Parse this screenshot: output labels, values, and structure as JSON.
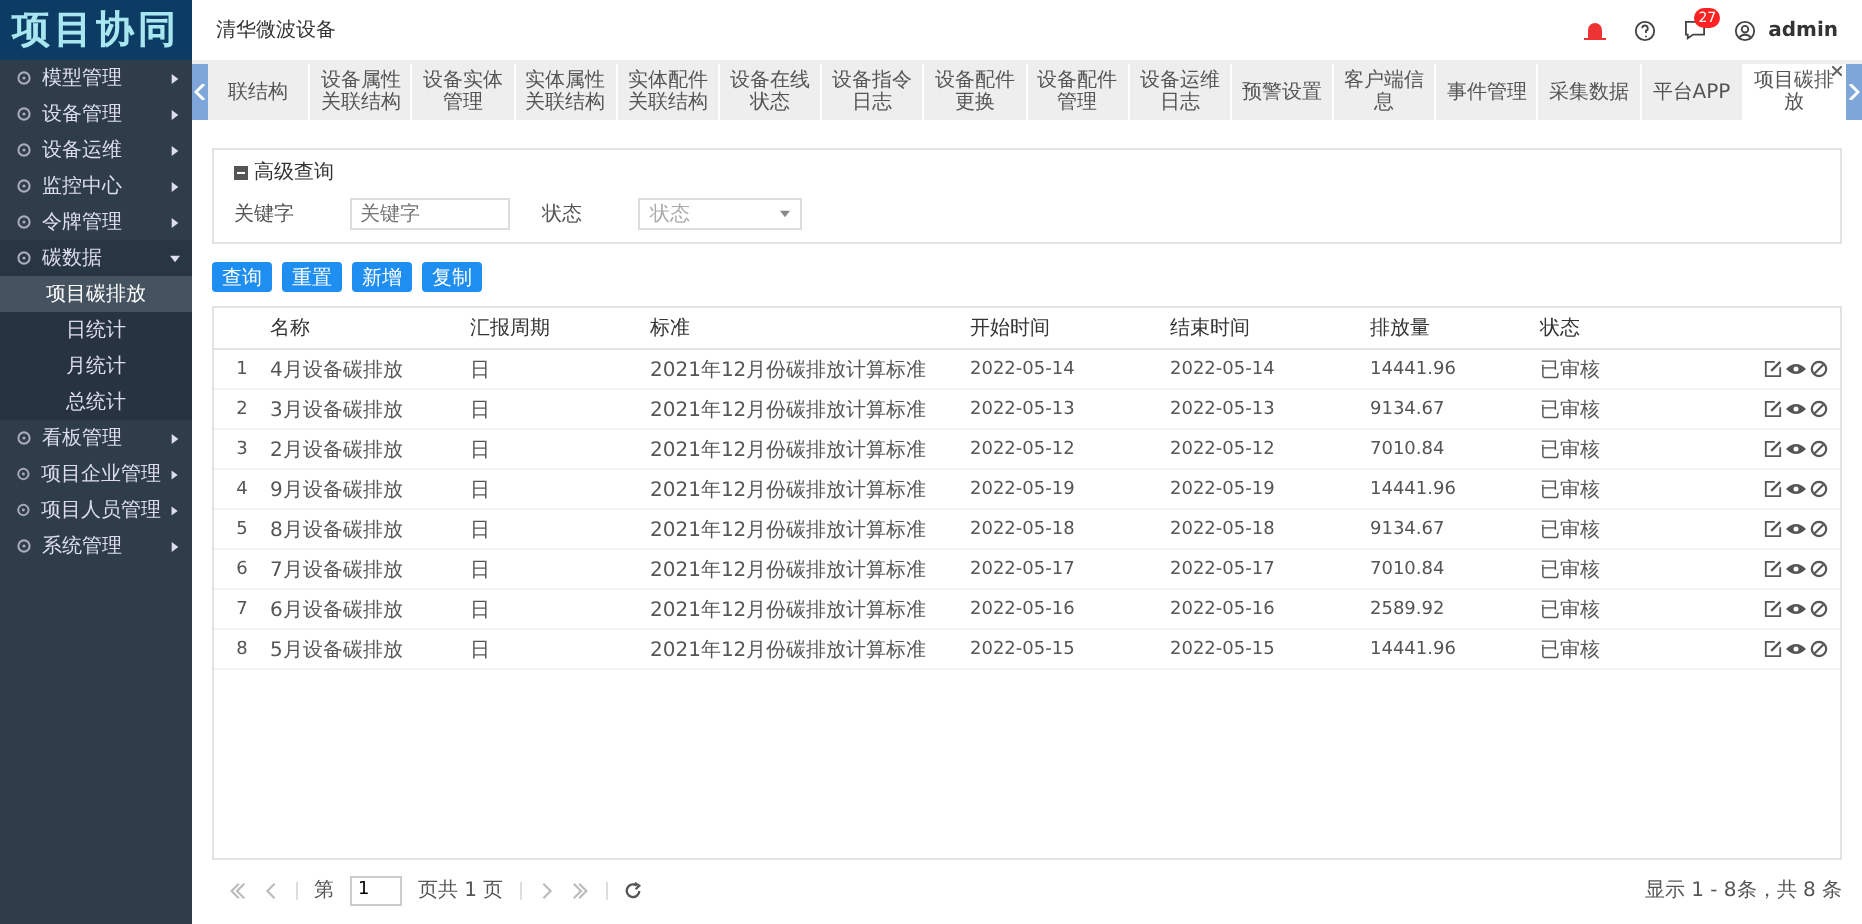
{
  "logo": "项目协同",
  "sidebar": {
    "items": [
      {
        "label": "模型管理",
        "expanded": false
      },
      {
        "label": "设备管理",
        "expanded": false
      },
      {
        "label": "设备运维",
        "expanded": false
      },
      {
        "label": "监控中心",
        "expanded": false
      },
      {
        "label": "令牌管理",
        "expanded": false
      },
      {
        "label": "碳数据",
        "expanded": true,
        "children": [
          {
            "label": "项目碳排放",
            "selected": true
          },
          {
            "label": "日统计",
            "selected": false
          },
          {
            "label": "月统计",
            "selected": false
          },
          {
            "label": "总统计",
            "selected": false
          }
        ]
      },
      {
        "label": "看板管理",
        "expanded": false
      },
      {
        "label": "项目企业管理",
        "expanded": false
      },
      {
        "label": "项目人员管理",
        "expanded": false
      },
      {
        "label": "系统管理",
        "expanded": false
      }
    ]
  },
  "header": {
    "title": "清华微波设备",
    "message_count": "27",
    "user": "admin"
  },
  "tabs": [
    {
      "label": "联结构",
      "selected": false,
      "closable": false
    },
    {
      "label": "设备属性关联结构",
      "selected": false,
      "closable": false
    },
    {
      "label": "设备实体管理",
      "selected": false,
      "closable": false
    },
    {
      "label": "实体属性关联结构",
      "selected": false,
      "closable": false
    },
    {
      "label": "实体配件关联结构",
      "selected": false,
      "closable": false
    },
    {
      "label": "设备在线状态",
      "selected": false,
      "closable": false
    },
    {
      "label": "设备指令日志",
      "selected": false,
      "closable": false
    },
    {
      "label": "设备配件更换",
      "selected": false,
      "closable": false
    },
    {
      "label": "设备配件管理",
      "selected": false,
      "closable": false
    },
    {
      "label": "设备运维日志",
      "selected": false,
      "closable": false
    },
    {
      "label": "预警设置",
      "selected": false,
      "closable": false
    },
    {
      "label": "客户端信息",
      "selected": false,
      "closable": false
    },
    {
      "label": "事件管理",
      "selected": false,
      "closable": false
    },
    {
      "label": "采集数据",
      "selected": false,
      "closable": false
    },
    {
      "label": "平台APP",
      "selected": false,
      "closable": false
    },
    {
      "label": "项目碳排放",
      "selected": true,
      "closable": true
    }
  ],
  "query": {
    "title": "高级查询",
    "keyword_label": "关键字",
    "keyword_placeholder": "关键字",
    "status_label": "状态",
    "status_placeholder": "状态"
  },
  "buttons": [
    "查询",
    "重置",
    "新增",
    "复制"
  ],
  "table": {
    "columns": [
      "",
      "名称",
      "汇报周期",
      "标准",
      "开始时间",
      "结束时间",
      "排放量",
      "状态"
    ],
    "rows": [
      [
        "1",
        "4月设备碳排放",
        "日",
        "2021年12月份碳排放计算标准",
        "2022-05-14",
        "2022-05-14",
        "14441.96",
        "已审核"
      ],
      [
        "2",
        "3月设备碳排放",
        "日",
        "2021年12月份碳排放计算标准",
        "2022-05-13",
        "2022-05-13",
        "9134.67",
        "已审核"
      ],
      [
        "3",
        "2月设备碳排放",
        "日",
        "2021年12月份碳排放计算标准",
        "2022-05-12",
        "2022-05-12",
        "7010.84",
        "已审核"
      ],
      [
        "4",
        "9月设备碳排放",
        "日",
        "2021年12月份碳排放计算标准",
        "2022-05-19",
        "2022-05-19",
        "14441.96",
        "已审核"
      ],
      [
        "5",
        "8月设备碳排放",
        "日",
        "2021年12月份碳排放计算标准",
        "2022-05-18",
        "2022-05-18",
        "9134.67",
        "已审核"
      ],
      [
        "6",
        "7月设备碳排放",
        "日",
        "2021年12月份碳排放计算标准",
        "2022-05-17",
        "2022-05-17",
        "7010.84",
        "已审核"
      ],
      [
        "7",
        "6月设备碳排放",
        "日",
        "2021年12月份碳排放计算标准",
        "2022-05-16",
        "2022-05-16",
        "2589.92",
        "已审核"
      ],
      [
        "8",
        "5月设备碳排放",
        "日",
        "2021年12月份碳排放计算标准",
        "2022-05-15",
        "2022-05-15",
        "14441.96",
        "已审核"
      ]
    ]
  },
  "pagination": {
    "page_prefix": "第",
    "page": "1",
    "page_suffix": "页共 1 页",
    "summary": "显示 1 - 8条，共 8 条"
  }
}
